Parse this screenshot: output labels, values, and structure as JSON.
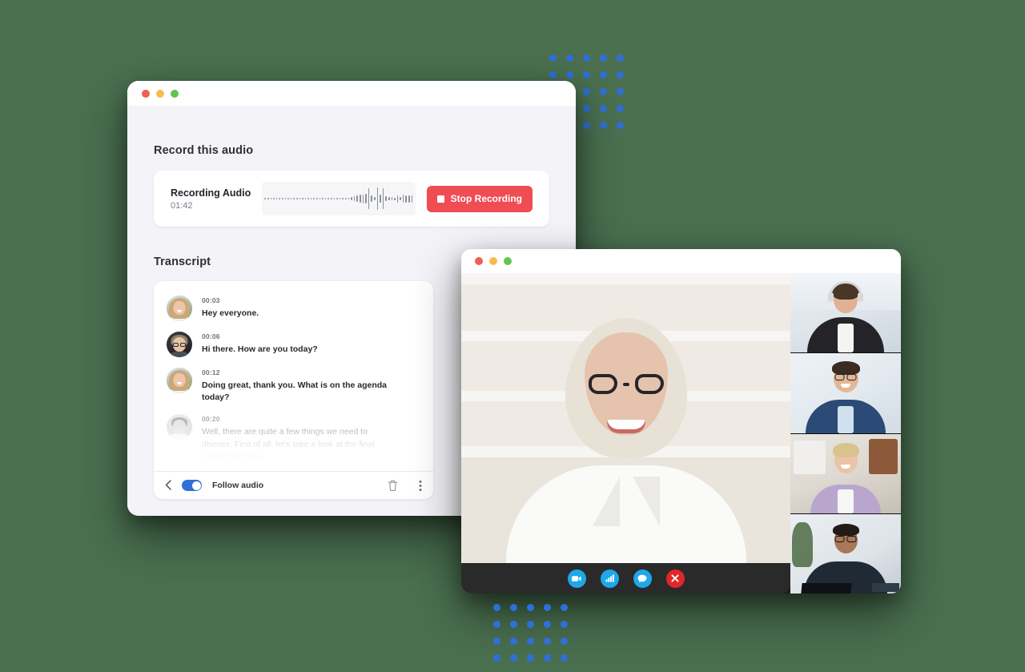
{
  "background": {
    "color": "#4a7050"
  },
  "decor": {
    "dot_grid_top": {
      "rows": 5,
      "cols": 5,
      "color": "#2f6fd8"
    },
    "dot_grid_bottom": {
      "rows": 4,
      "cols": 5,
      "color": "#2f6fd8"
    }
  },
  "recorder_window": {
    "traffic_lights": [
      "close",
      "minimize",
      "maximize"
    ],
    "record_section": {
      "title": "Record this audio",
      "card": {
        "label": "Recording Audio",
        "elapsed": "01:42",
        "waveform_icon": "audio-waveform",
        "stop_button": {
          "label": "Stop Recording",
          "icon": "stop-square-icon",
          "color": "#ef4c54"
        }
      }
    },
    "transcript_section": {
      "title": "Transcript",
      "entries": [
        {
          "time": "00:03",
          "text": "Hey everyone.",
          "speaker_avatar": "woman-blonde-avatar",
          "faded": false
        },
        {
          "time": "00:06",
          "text": "Hi there. How are you today?",
          "speaker_avatar": "man-glasses-avatar",
          "faded": false
        },
        {
          "time": "00:12",
          "text": "Doing great, thank you. What is on the agenda today?",
          "speaker_avatar": "woman-blonde-avatar",
          "faded": false
        },
        {
          "time": "00:20",
          "text": "Well, there are quite a few things we need to discuss. First of all, let's take a look at the final project brief and",
          "speaker_avatar": "man-avatar",
          "faded": true
        }
      ],
      "footer": {
        "back_icon": "chevron-left-icon",
        "follow_audio_label": "Follow audio",
        "follow_audio_on": true,
        "toggle_color": "#2f6fd8",
        "delete_icon": "trash-icon",
        "more_icon": "more-vertical-icon"
      }
    }
  },
  "videocall_window": {
    "traffic_lights": [
      "close",
      "minimize",
      "maximize"
    ],
    "main_speaker": "woman-glasses-white-blouse-bookshelf",
    "participants": [
      "man-headset-writing",
      "man-glasses-blue-suit",
      "woman-blonde-purple-sweater",
      "man-glasses-dark-shirt-laptop"
    ],
    "toolbar": {
      "background": "#2b2a2a",
      "buttons": [
        {
          "name": "camera",
          "icon": "video-camera-icon",
          "color": "#1ea8e8"
        },
        {
          "name": "signal",
          "icon": "signal-bars-icon",
          "color": "#1ea8e8"
        },
        {
          "name": "chat",
          "icon": "chat-bubble-icon",
          "color": "#1ea8e8"
        },
        {
          "name": "end-call",
          "icon": "close-x-icon",
          "color": "#e3262a"
        }
      ]
    }
  }
}
